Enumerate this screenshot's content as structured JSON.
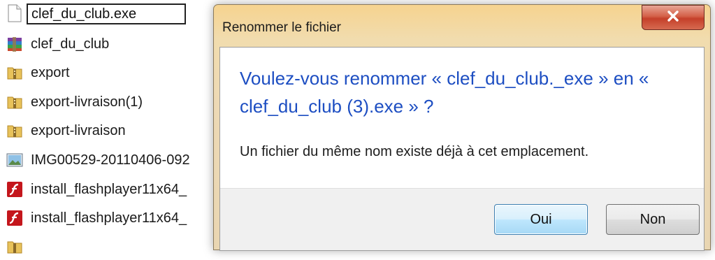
{
  "explorer": {
    "rename_value": "clef_du_club.exe",
    "files": [
      {
        "label": "clef_du_club",
        "icon": "winrar-archive-icon"
      },
      {
        "label": "export",
        "icon": "zip-folder-icon"
      },
      {
        "label": "export-livraison(1)",
        "icon": "zip-folder-icon"
      },
      {
        "label": "export-livraison",
        "icon": "zip-folder-icon"
      },
      {
        "label": "IMG00529-20110406-092",
        "icon": "image-file-icon"
      },
      {
        "label": "install_flashplayer11x64_",
        "icon": "flash-installer-icon"
      },
      {
        "label": "install_flashplayer11x64_",
        "icon": "flash-installer-icon"
      }
    ]
  },
  "dialog": {
    "title": "Renommer le fichier",
    "main_instruction": "Voulez-vous renommer « clef_du_club._exe » en « clef_du_club (3).exe » ?",
    "content": "Un fichier du même nom existe déjà à cet emplacement.",
    "yes_label": "Oui",
    "no_label": "Non",
    "close_icon": "close-icon"
  },
  "colors": {
    "instruction_blue": "#1d4ec2",
    "title_gradient_top": "#f6d38f",
    "close_red": "#c5402a"
  }
}
